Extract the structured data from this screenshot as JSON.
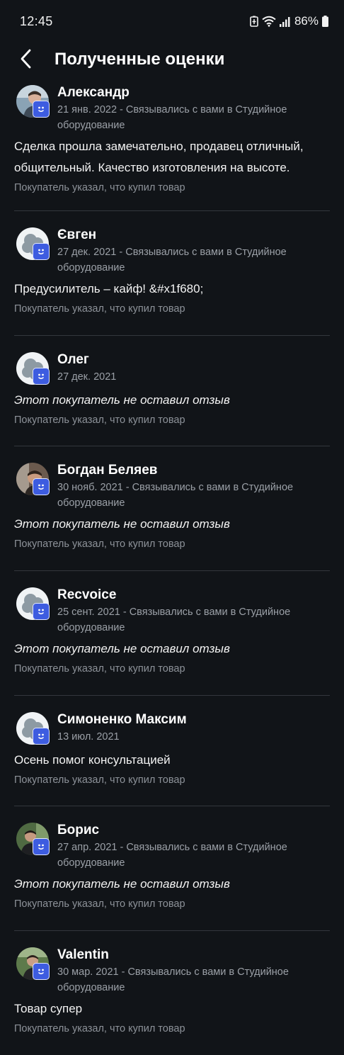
{
  "status_bar": {
    "time": "12:45",
    "battery_percent": "86%",
    "icons": [
      "battery-saver-icon",
      "wifi-icon",
      "signal-icon",
      "battery-icon"
    ]
  },
  "header": {
    "back_icon": "chevron-left-icon",
    "title": "Полученные оценки"
  },
  "colors": {
    "background": "#111418",
    "badge": "#3d5ce0",
    "meta_text": "#9ba0a7",
    "divider": "#33373d"
  },
  "reviews": [
    {
      "name": "Александр",
      "avatar": "photo",
      "meta": "21 янв. 2022 - Связывались с вами в Студийное оборудование",
      "text": "Сделка прошла замечательно, продавец отличный, общительный. Качество изготовления на высоте.",
      "empty": false,
      "note": "Покупатель указал, что купил товар"
    },
    {
      "name": "Євген",
      "avatar": "placeholder",
      "meta": "27 дек. 2021 - Связывались с вами в Студийное оборудование",
      "text": "Предусилитель – кайф! &#x1f680;",
      "empty": false,
      "note": "Покупатель указал, что купил товар"
    },
    {
      "name": "Олег",
      "avatar": "placeholder",
      "meta": "27 дек. 2021",
      "text": "Этот покупатель не оставил отзыв",
      "empty": true,
      "note": "Покупатель указал, что купил товар"
    },
    {
      "name": "Богдан Беляев",
      "avatar": "photo",
      "meta": "30 нояб. 2021 - Связывались с вами в Студийное оборудование",
      "text": "Этот покупатель не оставил отзыв",
      "empty": true,
      "note": "Покупатель указал, что купил товар"
    },
    {
      "name": "Recvoice",
      "avatar": "placeholder",
      "meta": "25 сент. 2021 - Связывались с вами в Студийное оборудование",
      "text": "Этот покупатель не оставил отзыв",
      "empty": true,
      "note": "Покупатель указал, что купил товар"
    },
    {
      "name": "Симоненко Максим",
      "avatar": "placeholder",
      "meta": "13 июл. 2021",
      "text": "Осень помог консультацией",
      "empty": false,
      "note": "Покупатель указал, что купил товар"
    },
    {
      "name": "Борис",
      "avatar": "photo",
      "meta": "27 апр. 2021 - Связывались с вами в Студийное оборудование",
      "text": "Этот покупатель не оставил отзыв",
      "empty": true,
      "note": "Покупатель указал, что купил товар"
    },
    {
      "name": "Valentin",
      "avatar": "photo",
      "meta": "30 мар. 2021 - Связывались с вами в Студийное оборудование",
      "text": "Товар супер",
      "empty": false,
      "note": "Покупатель указал, что купил товар"
    }
  ]
}
